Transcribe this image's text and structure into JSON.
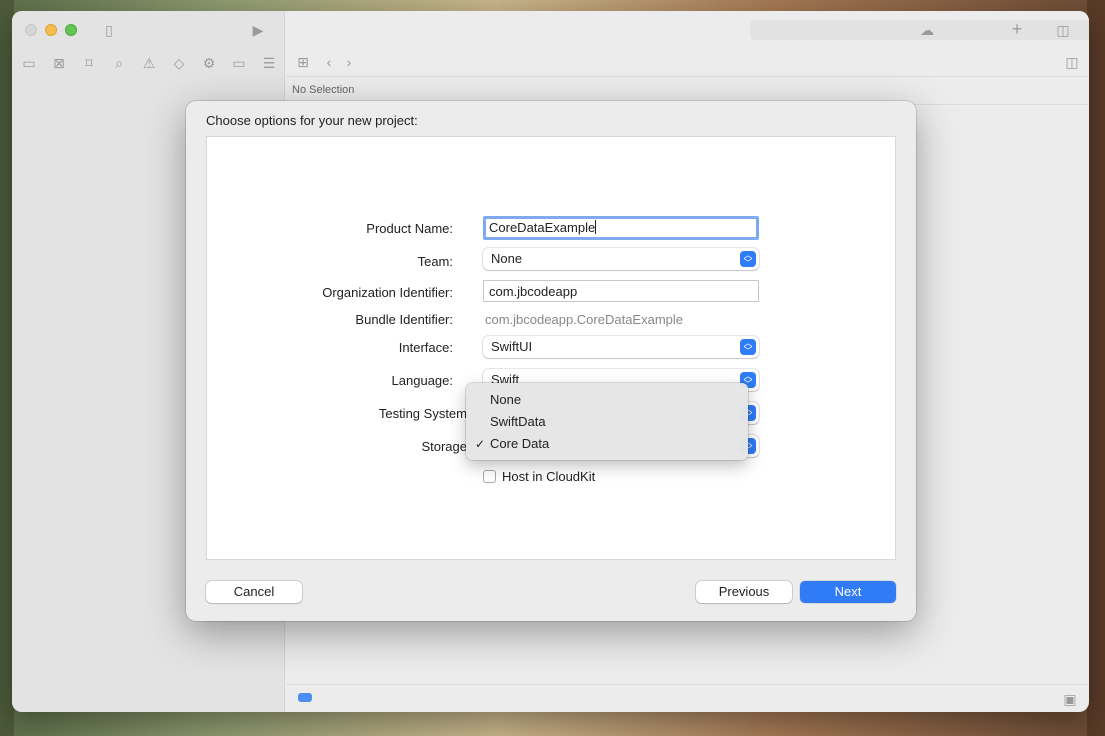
{
  "window": {
    "status_text": "No Selection"
  },
  "dialog": {
    "title": "Choose options for your new project:",
    "fields": {
      "product_name": {
        "label": "Product Name:",
        "value": "CoreDataExample"
      },
      "team": {
        "label": "Team:",
        "value": "None"
      },
      "org_identifier": {
        "label": "Organization Identifier:",
        "value": "com.jbcodeapp"
      },
      "bundle_identifier": {
        "label": "Bundle Identifier:",
        "value": "com.jbcodeapp.CoreDataExample"
      },
      "interface": {
        "label": "Interface:",
        "value": "SwiftUI"
      },
      "language": {
        "label": "Language:",
        "value": "Swift"
      },
      "testing_system": {
        "label": "Testing System"
      },
      "storage": {
        "label": "Storage"
      }
    },
    "storage_menu": {
      "options": [
        "None",
        "SwiftData",
        "Core Data"
      ],
      "selected": "Core Data"
    },
    "cloudkit": {
      "label": "Host in CloudKit",
      "checked": false
    },
    "buttons": {
      "cancel": "Cancel",
      "previous": "Previous",
      "next": "Next"
    }
  },
  "colors": {
    "accent": "#2f7cf6",
    "focus_ring": "#7fa9f0",
    "tl_close": "#d6d6d6",
    "tl_min": "#f5bd4f",
    "tl_max": "#62c554"
  },
  "icons": {
    "toolbar": [
      "sidebar-icon",
      "run-icon",
      "cloud-icon",
      "plus-icon",
      "inspector-icon"
    ],
    "navigator": [
      "folder-icon",
      "source-control-icon",
      "bookmark-icon",
      "search-icon",
      "warning-icon",
      "test-icon",
      "debug-icon",
      "breakpoint-icon",
      "report-icon"
    ]
  }
}
